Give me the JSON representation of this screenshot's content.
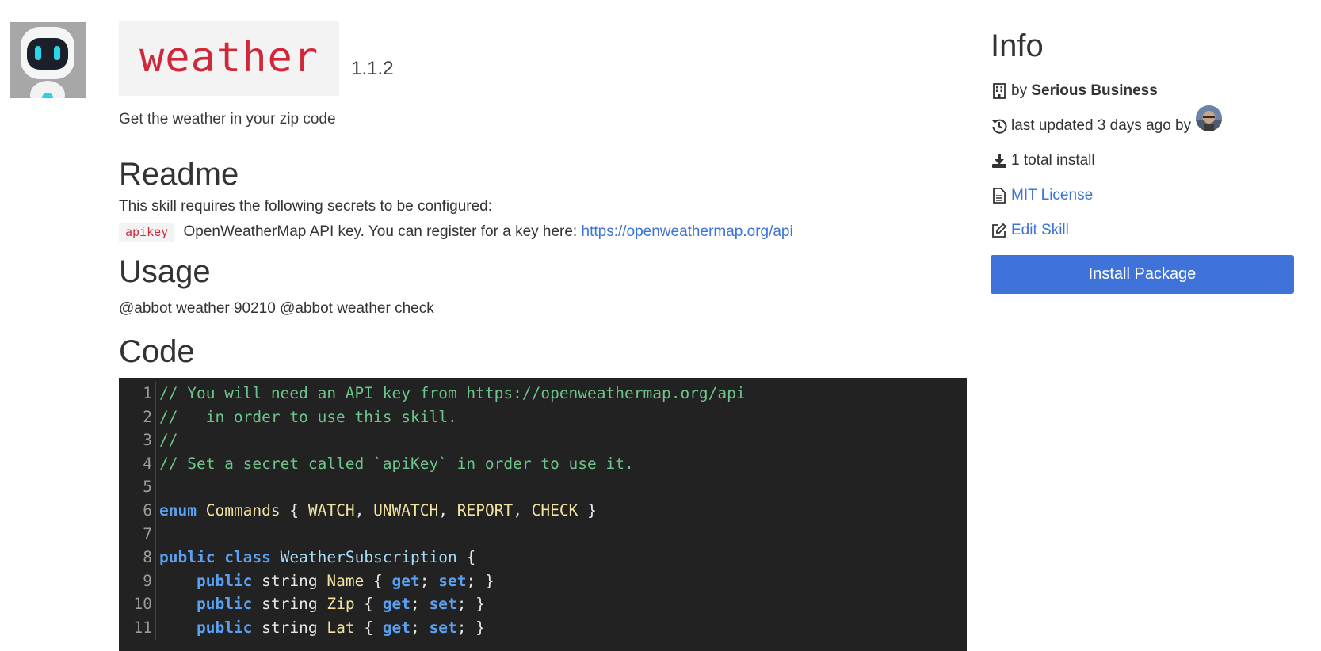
{
  "package": {
    "name": "weather",
    "version": "1.1.2",
    "description": "Get the weather in your zip code"
  },
  "readme": {
    "heading": "Readme",
    "intro": "This skill requires the following secrets to be configured:",
    "secret_key": "apikey",
    "secret_desc": "OpenWeatherMap API key. You can register for a key here:",
    "secret_link": "https://openweathermap.org/api"
  },
  "usage": {
    "heading": "Usage",
    "text": "@abbot weather 90210 @abbot weather check"
  },
  "code": {
    "heading": "Code",
    "line_numbers": [
      "1",
      "2",
      "3",
      "4",
      "5",
      "6",
      "7",
      "8",
      "9",
      "10",
      "11"
    ]
  },
  "info": {
    "heading": "Info",
    "by_prefix": "by",
    "author": "Serious Business",
    "updated": "last updated 3 days ago by",
    "installs": "1 total install",
    "license": "MIT License",
    "edit": "Edit Skill",
    "install_button": "Install Package"
  },
  "icons": {
    "building": "building-icon",
    "history": "history-icon",
    "download": "download-icon",
    "file": "file-icon",
    "edit": "edit-icon"
  },
  "colors": {
    "accent": "#3f73d9",
    "link": "#3b73d6",
    "code_name": "#d0283a",
    "code_bg": "#222222"
  }
}
